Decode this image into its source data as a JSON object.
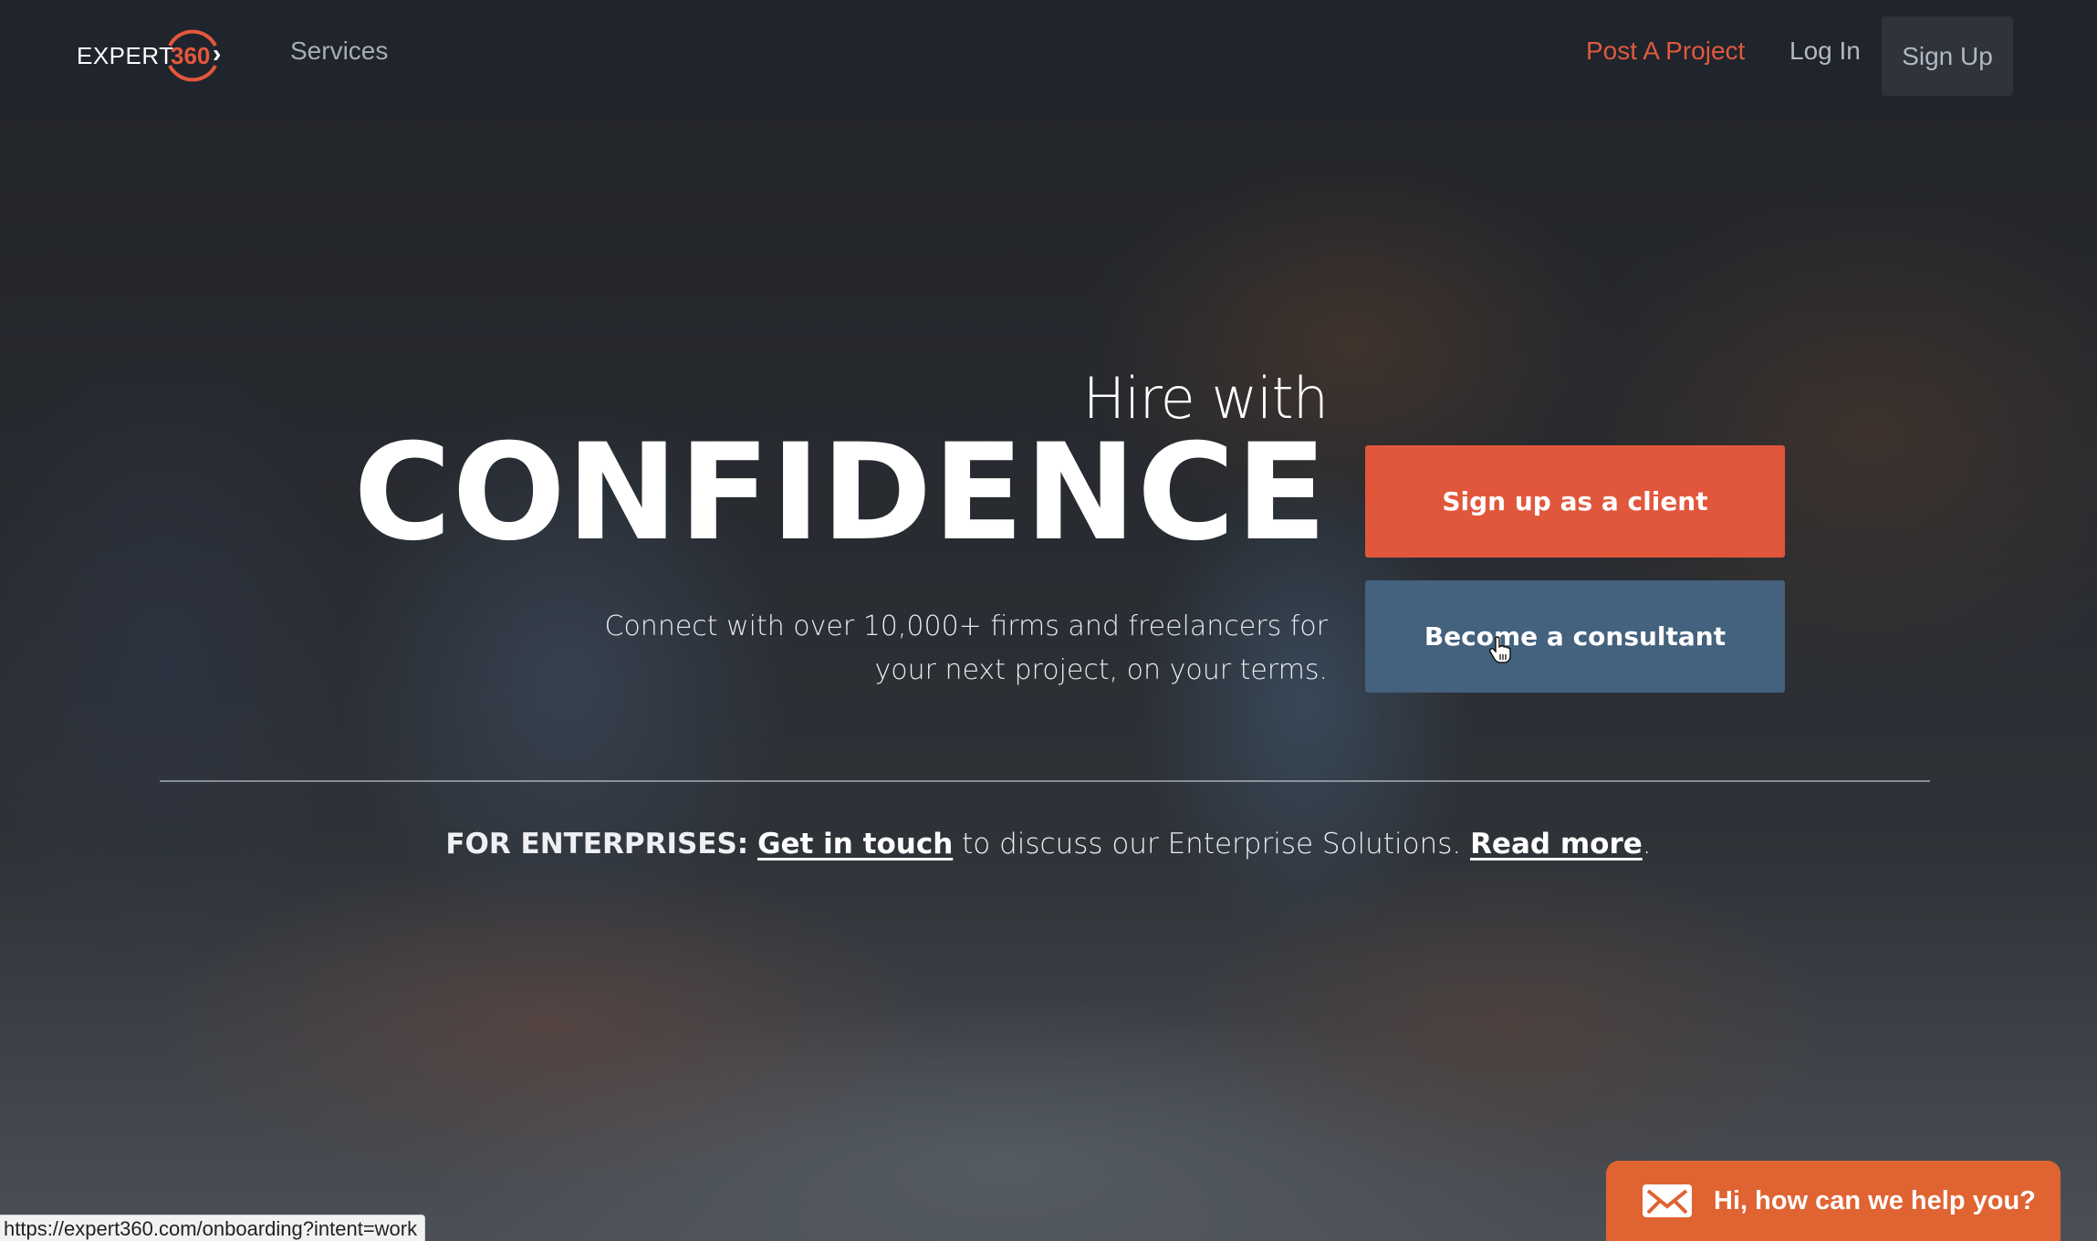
{
  "nav": {
    "logo_word": "EXPERT",
    "logo_number": "360",
    "logo_chevron": "›",
    "services": "Services",
    "post_project": "Post A Project",
    "log_in": "Log In",
    "sign_up": "Sign Up"
  },
  "hero": {
    "eyebrow": "Hire with",
    "headline": "CONFIDENCE",
    "subtitle": "Connect with over 10,000+ firms and freelancers for your next project, on your terms.",
    "cta_client": "Sign up as a client",
    "cta_consultant": "Become a consultant"
  },
  "enterprise": {
    "label": "FOR ENTERPRISES:",
    "link_contact": "Get in touch",
    "middle_text": " to discuss our Enterprise Solutions. ",
    "link_read_more": "Read more",
    "end": "."
  },
  "status_bar": {
    "url": "https://expert360.com/onboarding?intent=work"
  },
  "chat_widget": {
    "icon": "mail-icon",
    "label": "Hi, how can we help you?"
  },
  "colors": {
    "nav_bg": "#20242c",
    "accent_orange": "#e1573c",
    "consultant_blue": "#44617d",
    "chat_orange": "#e06332"
  }
}
